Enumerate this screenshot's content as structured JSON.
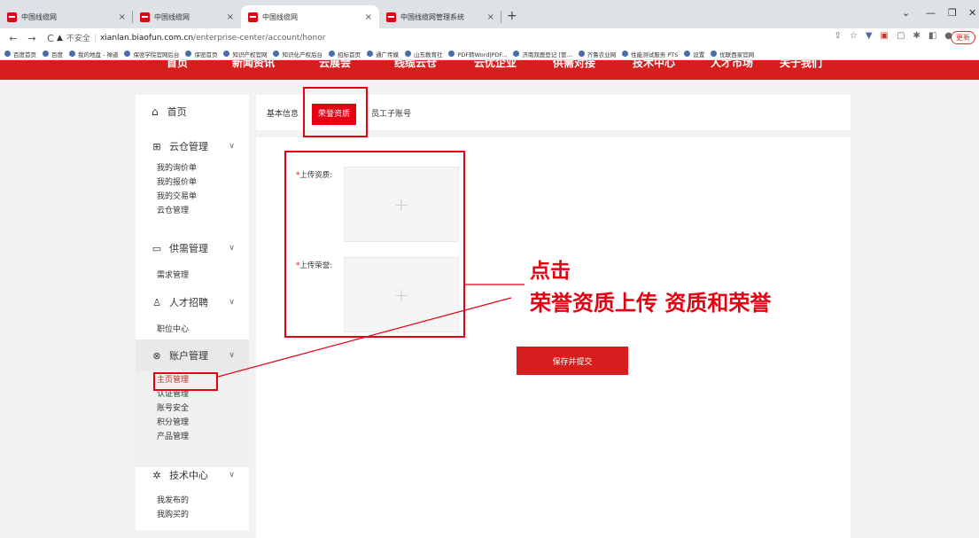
{
  "browser": {
    "tabs": [
      {
        "title": "中国线缆网"
      },
      {
        "title": "中国线缆网"
      },
      {
        "title": "中国线缆网"
      },
      {
        "title": "中国线缆网管理系统"
      }
    ],
    "address": {
      "security": "不安全",
      "host": "xianlan.biaofun.com.cn",
      "path": "/enterprise-center/account/honor"
    },
    "update_label": "更新",
    "bookmarks": [
      "百度首页",
      "百度",
      "我的地盘 - 禅道",
      "保密学院官网后台",
      "保密首页",
      "知识产权官网",
      "知识化产权后台",
      "招标首页",
      "通广传媒",
      "山东教育社",
      "PDF转Word|PDF...",
      "济南双鹿登记 [管...",
      "齐鲁农业网",
      "性能测试服务 PTS",
      "设置",
      "优联西家官网"
    ]
  },
  "site_nav": [
    "首页",
    "新闻资讯",
    "云展会",
    "线缆云仓",
    "云优企业",
    "供需对接",
    "技术中心",
    "人才市场",
    "关于我们"
  ],
  "sidebar": {
    "home": "首页",
    "groups": [
      {
        "title": "云仓管理",
        "icon": "grid-icon",
        "items": [
          "我的询价单",
          "我的报价单",
          "我的交易单",
          "云仓管理"
        ]
      },
      {
        "title": "供需管理",
        "icon": "calendar-icon",
        "items": [
          "需求管理"
        ]
      },
      {
        "title": "人才招聘",
        "icon": "person-icon",
        "items": [
          "职位中心"
        ]
      },
      {
        "title": "账户管理",
        "icon": "account-icon",
        "items": [
          "主页管理",
          "认证管理",
          "账号安全",
          "积分管理",
          "产品管理"
        ]
      },
      {
        "title": "技术中心",
        "icon": "gear-icon",
        "items": [
          "我发布的",
          "我购买的"
        ]
      }
    ]
  },
  "page_tabs": [
    "基本信息",
    "荣誉资质",
    "员工子账号"
  ],
  "form": {
    "quals_label": "上传资质:",
    "honors_label": "上传荣誉:",
    "required_mark": "*",
    "submit_label": "保存并提交"
  },
  "annotation": {
    "line1": "点击",
    "line2": "荣誉资质上传 资质和荣誉"
  },
  "colors": {
    "brand_red": "#d71e1e",
    "annotation_red": "#e60012"
  }
}
